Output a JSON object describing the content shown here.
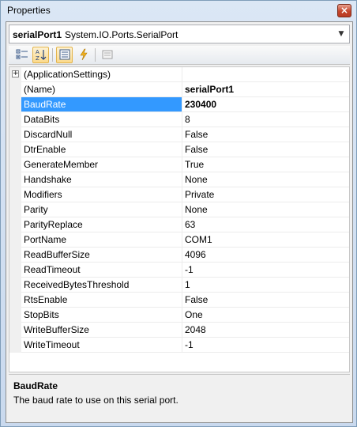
{
  "window": {
    "title": "Properties",
    "close_symbol": "×"
  },
  "object_selector": {
    "name": "serialPort1",
    "type": "System.IO.Ports.SerialPort",
    "arrow": "▼"
  },
  "toolbar": {
    "categorized_icon": "categorized-icon",
    "alphabetical_icon": "alphabetical-icon",
    "properties_icon": "properties-icon",
    "events_icon": "events-icon",
    "property_pages_icon": "property-pages-icon"
  },
  "grid": {
    "group": {
      "name": "(ApplicationSettings)",
      "expander": "+"
    },
    "rows": [
      {
        "name": "(Name)",
        "value": "serialPort1",
        "bold_value": true,
        "selected": false
      },
      {
        "name": "BaudRate",
        "value": "230400",
        "bold_value": true,
        "selected": true
      },
      {
        "name": "DataBits",
        "value": "8",
        "bold_value": false,
        "selected": false
      },
      {
        "name": "DiscardNull",
        "value": "False",
        "bold_value": false,
        "selected": false
      },
      {
        "name": "DtrEnable",
        "value": "False",
        "bold_value": false,
        "selected": false
      },
      {
        "name": "GenerateMember",
        "value": "True",
        "bold_value": false,
        "selected": false
      },
      {
        "name": "Handshake",
        "value": "None",
        "bold_value": false,
        "selected": false
      },
      {
        "name": "Modifiers",
        "value": "Private",
        "bold_value": false,
        "selected": false
      },
      {
        "name": "Parity",
        "value": "None",
        "bold_value": false,
        "selected": false
      },
      {
        "name": "ParityReplace",
        "value": "63",
        "bold_value": false,
        "selected": false
      },
      {
        "name": "PortName",
        "value": "COM1",
        "bold_value": false,
        "selected": false
      },
      {
        "name": "ReadBufferSize",
        "value": "4096",
        "bold_value": false,
        "selected": false
      },
      {
        "name": "ReadTimeout",
        "value": "-1",
        "bold_value": false,
        "selected": false
      },
      {
        "name": "ReceivedBytesThreshold",
        "value": "1",
        "bold_value": false,
        "selected": false
      },
      {
        "name": "RtsEnable",
        "value": "False",
        "bold_value": false,
        "selected": false
      },
      {
        "name": "StopBits",
        "value": "One",
        "bold_value": false,
        "selected": false
      },
      {
        "name": "WriteBufferSize",
        "value": "2048",
        "bold_value": false,
        "selected": false
      },
      {
        "name": "WriteTimeout",
        "value": "-1",
        "bold_value": false,
        "selected": false
      }
    ]
  },
  "description": {
    "title": "BaudRate",
    "text": "The baud rate to use on this serial port."
  },
  "colors": {
    "selection": "#3399ff",
    "window_frame": "#c9d9ee",
    "panel": "#f0f0f0"
  }
}
